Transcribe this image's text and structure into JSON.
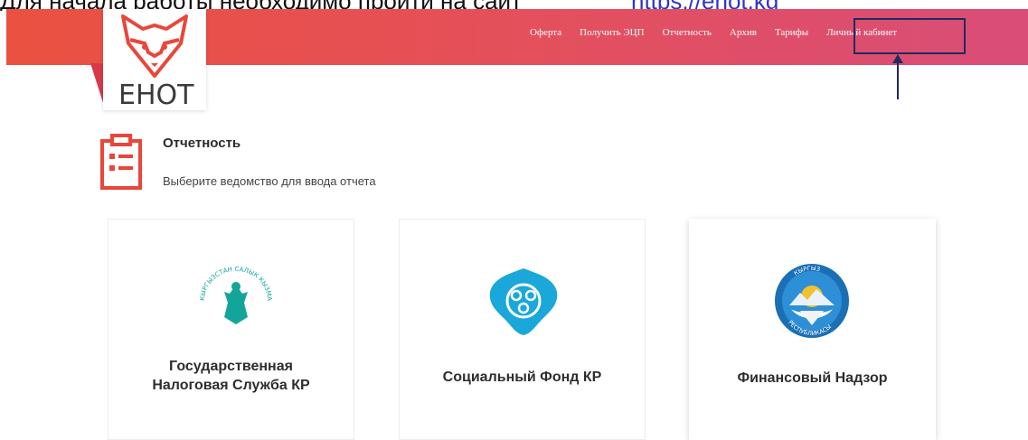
{
  "top_cutoff": {
    "text": "Для начала работы необходимо пройти на сайт",
    "link": "https://enot.kg"
  },
  "brand": {
    "logo_text": "ЕНОТ"
  },
  "nav": {
    "items": [
      "Оферта",
      "Получить ЭЦП",
      "Отчетность",
      "Архив",
      "Тарифы",
      "Личный кабинет"
    ]
  },
  "page": {
    "title": "Отчетность",
    "subtitle": "Выберите ведомство для ввода отчета"
  },
  "cards": [
    {
      "label_line1": "Государственная",
      "label_line2": "Налоговая Служба КР",
      "logo_text": "КЫРГЫЗСТАН САЛЫК КЫЗМАТЫ"
    },
    {
      "label": "Социальный Фонд КР"
    },
    {
      "label": "Финансовый Надзор",
      "logo_text_top": "КЫРГЫЗ",
      "logo_text_bottom": "РЕСПУБЛИКАСЫ"
    }
  ],
  "colors": {
    "header_start": "#ea5140",
    "header_end": "#d94d78",
    "accent": "#e8473a",
    "highlight_box": "#1f2a60",
    "social_fund": "#1aa7d9",
    "tax_service": "#14a59a"
  }
}
